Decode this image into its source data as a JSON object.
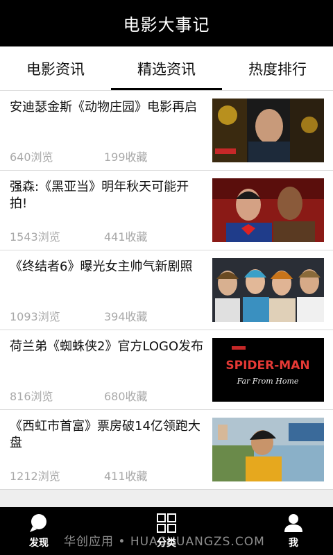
{
  "header": {
    "title": "电影大事记"
  },
  "tabs": [
    {
      "label": "电影资讯",
      "active": false
    },
    {
      "label": "精选资讯",
      "active": true
    },
    {
      "label": "热度排行",
      "active": false
    }
  ],
  "articles": [
    {
      "title": "安迪瑟金斯《动物庄园》电影再启",
      "views": "640浏览",
      "favorites": "199收藏"
    },
    {
      "title": "强森:《黑亚当》明年秋天可能开拍!",
      "views": "1543浏览",
      "favorites": "441收藏"
    },
    {
      "title": "《终结者6》曝光女主帅气新剧照",
      "views": "1093浏览",
      "favorites": "394收藏"
    },
    {
      "title": "荷兰弟《蜘蛛侠2》官方LOGO发布",
      "views": "816浏览",
      "favorites": "680收藏",
      "thumb_text": {
        "line1": "SPIDER-MAN",
        "line2": "Far From Home"
      }
    },
    {
      "title": "《西虹市首富》票房破14亿领跑大盘",
      "views": "1212浏览",
      "favorites": "411收藏"
    }
  ],
  "bottom_nav": [
    {
      "label": "发现",
      "icon": "search-icon"
    },
    {
      "label": "分类",
      "icon": "grid-icon"
    },
    {
      "label": "我",
      "icon": "user-icon"
    }
  ],
  "watermark": "华创应用 • HUACHUANGZS.COM"
}
